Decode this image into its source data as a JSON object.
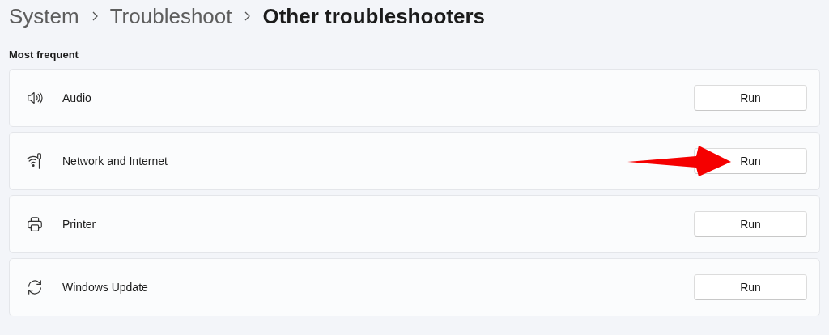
{
  "breadcrumb": [
    {
      "label": "System",
      "current": false
    },
    {
      "label": "Troubleshoot",
      "current": false
    },
    {
      "label": "Other troubleshooters",
      "current": true
    }
  ],
  "section": {
    "title": "Most frequent"
  },
  "items": [
    {
      "kind": "audio",
      "label": "Audio",
      "button": "Run",
      "arrow": false
    },
    {
      "kind": "network",
      "label": "Network and Internet",
      "button": "Run",
      "arrow": true
    },
    {
      "kind": "printer",
      "label": "Printer",
      "button": "Run",
      "arrow": false
    },
    {
      "kind": "update",
      "label": "Windows Update",
      "button": "Run",
      "arrow": false
    }
  ]
}
